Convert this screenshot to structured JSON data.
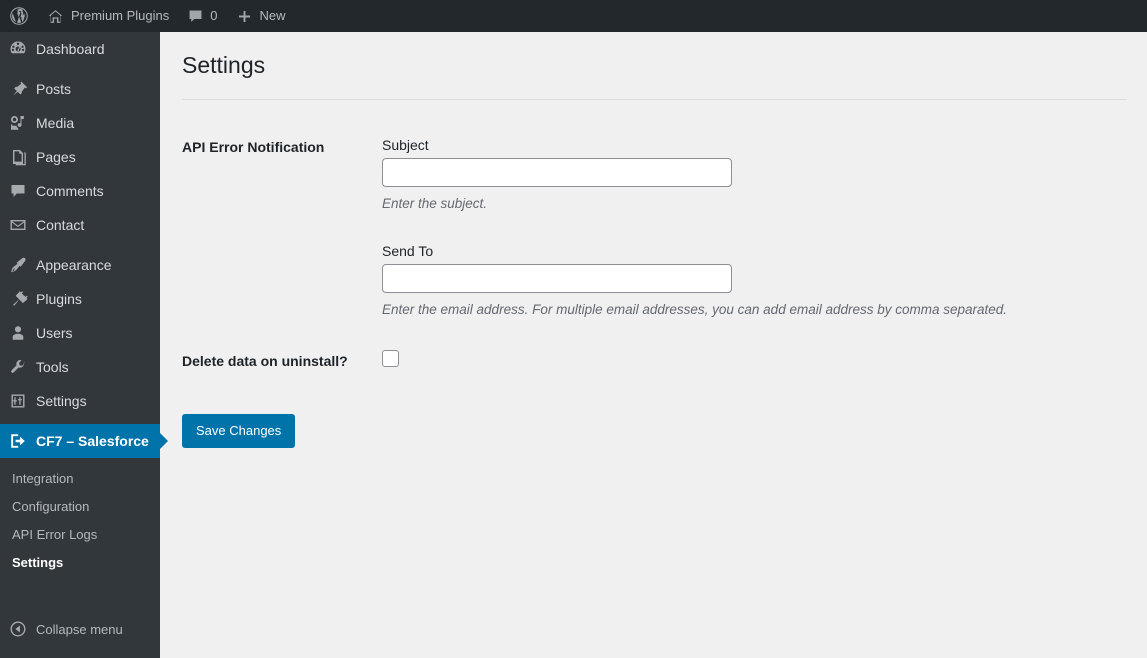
{
  "adminbar": {
    "logo_icon": "wordpress-logo-icon",
    "site": {
      "icon": "home-icon",
      "label": "Premium Plugins"
    },
    "comments": {
      "icon": "comment-bubble-icon",
      "count": "0"
    },
    "new": {
      "icon": "plus-icon",
      "label": "New"
    }
  },
  "sidebar": {
    "items": [
      {
        "icon": "dashboard-icon",
        "label": "Dashboard",
        "key": "dashboard",
        "sep_after": true
      },
      {
        "icon": "pin-icon",
        "label": "Posts",
        "key": "posts",
        "sep_after": false
      },
      {
        "icon": "media-icon",
        "label": "Media",
        "key": "media",
        "sep_after": false
      },
      {
        "icon": "page-icon",
        "label": "Pages",
        "key": "pages",
        "sep_after": false
      },
      {
        "icon": "comment-bubble-icon",
        "label": "Comments",
        "key": "comments",
        "sep_after": false
      },
      {
        "icon": "envelope-icon",
        "label": "Contact",
        "key": "contact",
        "sep_after": true
      },
      {
        "icon": "paintbrush-icon",
        "label": "Appearance",
        "key": "appearance",
        "sep_after": false
      },
      {
        "icon": "plug-icon",
        "label": "Plugins",
        "key": "plugins",
        "sep_after": false
      },
      {
        "icon": "user-icon",
        "label": "Users",
        "key": "users",
        "sep_after": false
      },
      {
        "icon": "wrench-icon",
        "label": "Tools",
        "key": "tools",
        "sep_after": false
      },
      {
        "icon": "settings-sliders-icon",
        "label": "Settings",
        "key": "settings",
        "sep_after": true
      }
    ],
    "current": {
      "icon": "exit-arrow-icon",
      "label": "CF7 – Salesforce",
      "key": "cf7-salesforce"
    },
    "submenu": [
      {
        "label": "Integration",
        "current": false
      },
      {
        "label": "Configuration",
        "current": false
      },
      {
        "label": "API Error Logs",
        "current": false
      },
      {
        "label": "Settings",
        "current": true
      }
    ],
    "collapse": {
      "icon": "collapse-left-arrow-icon",
      "label": "Collapse menu"
    }
  },
  "page": {
    "title": "Settings",
    "sections": [
      {
        "label": "API Error Notification",
        "fields": [
          {
            "label": "Subject",
            "value": "",
            "placeholder": "",
            "description": "Enter the subject."
          },
          {
            "label": "Send To",
            "value": "",
            "placeholder": "",
            "description": "Enter the email address. For multiple email addresses, you can add email address by comma separated."
          }
        ]
      },
      {
        "label": "Delete data on uninstall?",
        "checkbox": {
          "checked": false
        }
      }
    ],
    "submit_label": "Save Changes"
  },
  "colors": {
    "adminbar_bg": "#23282d",
    "sidebar_bg": "#32373c",
    "accent_blue": "#0073aa",
    "content_bg": "#f0f0f1",
    "text_dark": "#1d2327",
    "text_muted": "#646970"
  }
}
